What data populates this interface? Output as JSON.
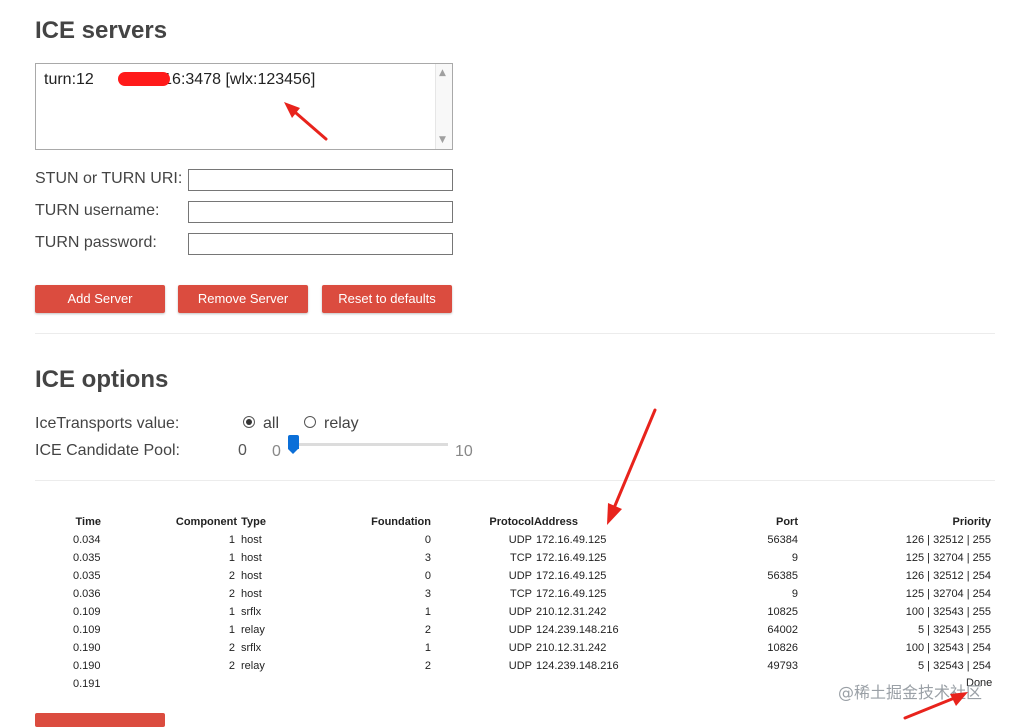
{
  "ice_servers": {
    "title": "ICE servers",
    "list": [
      {
        "prefix": "turn:12",
        "suffix": ".216:3478 [wlx:123456]"
      }
    ],
    "fields": [
      {
        "label": "STUN or TURN URI:",
        "value": ""
      },
      {
        "label": "TURN username:",
        "value": ""
      },
      {
        "label": "TURN password:",
        "value": ""
      }
    ],
    "buttons": {
      "add": "Add Server",
      "remove": "Remove Server",
      "reset": "Reset to defaults"
    }
  },
  "ice_options": {
    "title": "ICE options",
    "transports_label": "IceTransports value:",
    "transport_options": [
      {
        "label": "all",
        "checked": true
      },
      {
        "label": "relay",
        "checked": false
      }
    ],
    "pool_label": "ICE Candidate Pool:",
    "pool_value": "0",
    "slider": {
      "min": "0",
      "max": "10",
      "value": 0
    }
  },
  "candidates": {
    "headers": [
      "Time",
      "Component",
      "Type",
      "Foundation",
      "Protocol",
      "Address",
      "Port",
      "Priority"
    ],
    "rows": [
      [
        "0.034",
        "1",
        "host",
        "0",
        "UDP",
        "172.16.49.125",
        "56384",
        "126 | 32512 | 255"
      ],
      [
        "0.035",
        "1",
        "host",
        "3",
        "TCP",
        "172.16.49.125",
        "9",
        "125 | 32704 | 255"
      ],
      [
        "0.035",
        "2",
        "host",
        "0",
        "UDP",
        "172.16.49.125",
        "56385",
        "126 | 32512 | 254"
      ],
      [
        "0.036",
        "2",
        "host",
        "3",
        "TCP",
        "172.16.49.125",
        "9",
        "125 | 32704 | 254"
      ],
      [
        "0.109",
        "1",
        "srflx",
        "1",
        "UDP",
        "210.12.31.242",
        "10825",
        "100 | 32543 | 255"
      ],
      [
        "0.109",
        "1",
        "relay",
        "2",
        "UDP",
        "124.239.148.216",
        "64002",
        "5 | 32543 | 255"
      ],
      [
        "0.190",
        "2",
        "srflx",
        "1",
        "UDP",
        "210.12.31.242",
        "10826",
        "100 | 32543 | 254"
      ],
      [
        "0.190",
        "2",
        "relay",
        "2",
        "UDP",
        "124.239.148.216",
        "49793",
        "5 | 32543 | 254"
      ]
    ],
    "final_time": "0.191",
    "done": "Done"
  },
  "watermark": "@稀土掘金技术社区",
  "colors": {
    "button": "#db4c3f",
    "annotation": "#e8231c",
    "slider": "#0b6fd8"
  }
}
